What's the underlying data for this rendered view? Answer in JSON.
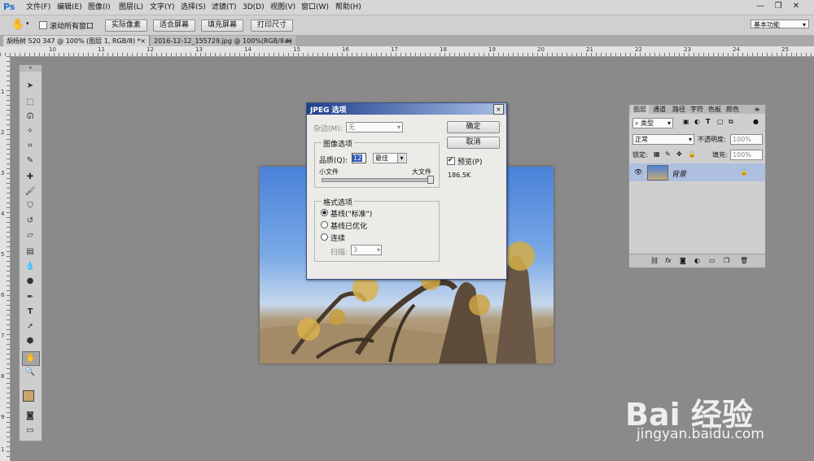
{
  "menubar": {
    "logo": "Ps",
    "items": [
      "文件(F)",
      "编辑(E)",
      "图像(I)",
      "图层(L)",
      "文字(Y)",
      "选择(S)",
      "滤镜(T)",
      "3D(D)",
      "视图(V)",
      "窗口(W)",
      "帮助(H)"
    ],
    "controls": [
      "—",
      "❐",
      "✕"
    ]
  },
  "options": {
    "hand_icon": "hand-icon",
    "scroll_all_label": "滚动所有窗口",
    "buttons": [
      "实际像素",
      "适合屏幕",
      "填充屏幕",
      "打印尺寸"
    ],
    "workspace": "基本功能"
  },
  "tabs": [
    {
      "label": "胡杨树 520 347 @ 100% (图层 1, RGB/8) *",
      "active": true
    },
    {
      "label": "2016-12-12_155729.jpg @ 100%(RGB/8#)",
      "active": false
    }
  ],
  "ruler_top": [
    "10",
    "11",
    "12",
    "13",
    "14",
    "15",
    "16",
    "17",
    "18",
    "19",
    "20",
    "21",
    "22",
    "23",
    "24",
    "25"
  ],
  "ruler_left": [
    "1",
    "2",
    "3",
    "4",
    "5",
    "6",
    "7",
    "8",
    "9",
    "1"
  ],
  "tools": [
    "move-icon",
    "marquee-icon",
    "lasso-icon",
    "quick-select-icon",
    "crop-icon",
    "eyedropper-icon",
    "heal-icon",
    "brush-icon",
    "stamp-icon",
    "history-brush-icon",
    "eraser-icon",
    "gradient-icon",
    "blur-icon",
    "dodge-icon",
    "pen-icon",
    "type-icon",
    "path-select-icon",
    "shape-icon",
    "hand-icon",
    "zoom-icon"
  ],
  "dialog": {
    "title": "JPEG 选项",
    "matte_label": "杂边(M):",
    "matte_value": "无",
    "ok": "确定",
    "cancel": "取消",
    "image_options": "图像选项",
    "quality_label": "品质(Q):",
    "quality_value": "12",
    "quality_preset": "最佳",
    "small_file": "小文件",
    "large_file": "大文件",
    "quality_fraction": 1.0,
    "preview_label": "预览(P)",
    "file_size": "186.5K",
    "format_options": "格式选项",
    "formats": [
      "基线(\"标准\")",
      "基线已优化",
      "连续"
    ],
    "scan_label": "扫描:",
    "scan_value": "3"
  },
  "layers": {
    "tabs": [
      "图层",
      "通道",
      "路径",
      "字符",
      "色板",
      "颜色"
    ],
    "filter": "类型",
    "blend_mode": "正常",
    "opacity_label": "不透明度:",
    "opacity_value": "100%",
    "lock_label": "锁定:",
    "fill_label": "填充:",
    "fill_value": "100%",
    "layer_name": "背景"
  },
  "watermark": {
    "logo": "Bai 经验",
    "url": "jingyan.baidu.com"
  }
}
